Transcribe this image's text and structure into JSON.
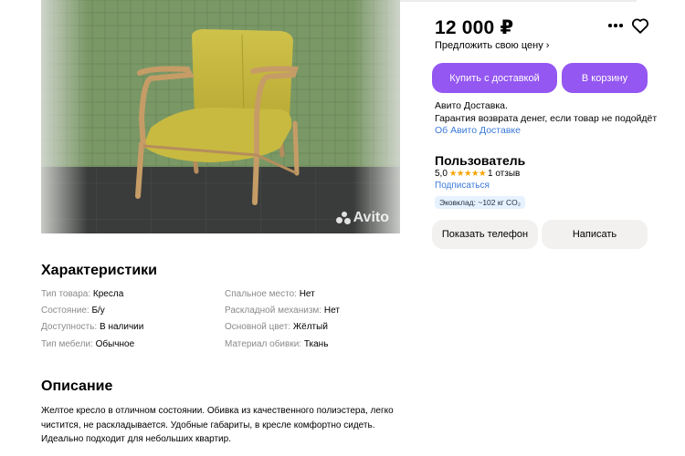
{
  "listing": {
    "price": "12 000 ₽",
    "offer_price": "Предложить свою цену",
    "buy_delivery": "Купить с доставкой",
    "add_to_cart": "В корзину",
    "photo_watermark": "Avito",
    "delivery_line1": "Авито Доставка.",
    "delivery_line2": "Гарантия возврата денег, если товар не подойдёт",
    "delivery_link": "Об Авито Доставке"
  },
  "seller": {
    "name": "Пользователь",
    "rating": "5,0",
    "stars": "★★★★★",
    "reviews": "1 отзыв",
    "subscribe": "Подписаться",
    "eco_badge": "Эковклад: ~102 кг CO₂",
    "show_phone": "Показать телефон",
    "write": "Написать"
  },
  "characteristics": {
    "title": "Характеристики",
    "left": [
      {
        "key": "Тип товара:",
        "value": "Кресла"
      },
      {
        "key": "Состояние:",
        "value": "Б/у"
      },
      {
        "key": "Доступность:",
        "value": "В наличии"
      },
      {
        "key": "Тип мебели:",
        "value": "Обычное"
      }
    ],
    "right": [
      {
        "key": "Спальное место:",
        "value": "Нет"
      },
      {
        "key": "Раскладной механизм:",
        "value": "Нет"
      },
      {
        "key": "Основной цвет:",
        "value": "Жёлтый"
      },
      {
        "key": "Материал обивки:",
        "value": "Ткань"
      }
    ]
  },
  "description": {
    "title": "Описание",
    "line1": "Желтое кресло в отличном состоянии. Обивка из качественного полиэстера, легко",
    "line2": "чистится, не раскладывается. Удобные габариты, в кресле комфортно сидеть.",
    "line3": "Идеально подходит для небольших квартир."
  },
  "colors": {
    "accent": "#9457f1",
    "link": "#3b79d9",
    "star": "#f7a300",
    "secondary_button": "#f2f1f0"
  },
  "icons": [
    "more-icon",
    "heart-icon",
    "chevron-right-icon",
    "avito-logo-icon"
  ]
}
